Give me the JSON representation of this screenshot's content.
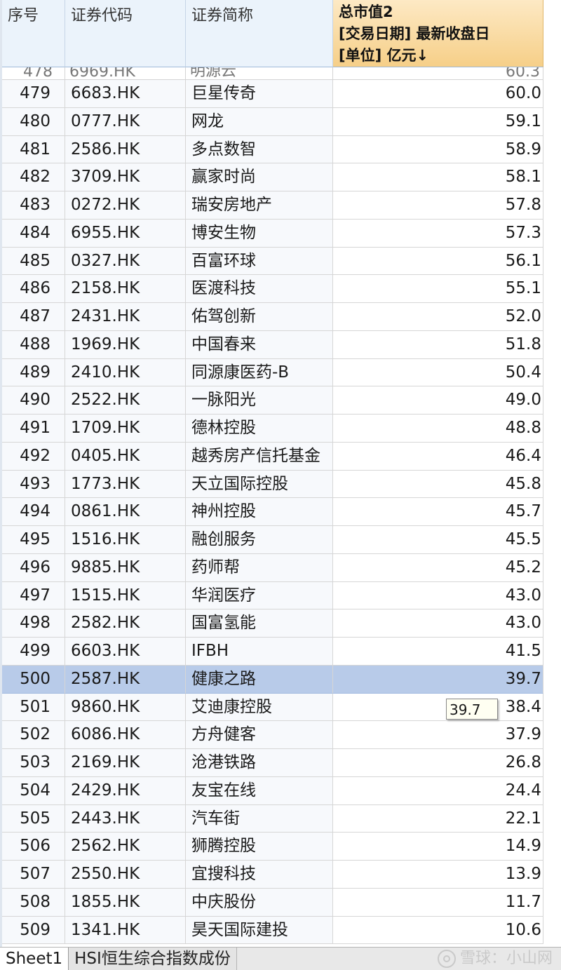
{
  "header": {
    "seq": "序号",
    "code": "证券代码",
    "name": "证券简称",
    "metric_line1": "总市值2",
    "metric_line2": "[交易日期] 最新收盘日",
    "metric_line3": "[单位] 亿元↓"
  },
  "rows": [
    {
      "seq": "479",
      "code": "6683.HK",
      "name": "巨星传奇",
      "val": "60.0"
    },
    {
      "seq": "480",
      "code": "0777.HK",
      "name": "网龙",
      "val": "59.1"
    },
    {
      "seq": "481",
      "code": "2586.HK",
      "name": "多点数智",
      "val": "58.9"
    },
    {
      "seq": "482",
      "code": "3709.HK",
      "name": "赢家时尚",
      "val": "58.1"
    },
    {
      "seq": "483",
      "code": "0272.HK",
      "name": "瑞安房地产",
      "val": "57.8"
    },
    {
      "seq": "484",
      "code": "6955.HK",
      "name": "博安生物",
      "val": "57.3"
    },
    {
      "seq": "485",
      "code": "0327.HK",
      "name": "百富环球",
      "val": "56.1"
    },
    {
      "seq": "486",
      "code": "2158.HK",
      "name": "医渡科技",
      "val": "55.1"
    },
    {
      "seq": "487",
      "code": "2431.HK",
      "name": "佑驾创新",
      "val": "52.0"
    },
    {
      "seq": "488",
      "code": "1969.HK",
      "name": "中国春来",
      "val": "51.8"
    },
    {
      "seq": "489",
      "code": "2410.HK",
      "name": "同源康医药-B",
      "val": "50.4"
    },
    {
      "seq": "490",
      "code": "2522.HK",
      "name": "一脉阳光",
      "val": "49.0"
    },
    {
      "seq": "491",
      "code": "1709.HK",
      "name": "德林控股",
      "val": "48.8"
    },
    {
      "seq": "492",
      "code": "0405.HK",
      "name": "越秀房产信托基金",
      "val": "46.4"
    },
    {
      "seq": "493",
      "code": "1773.HK",
      "name": "天立国际控股",
      "val": "45.8"
    },
    {
      "seq": "494",
      "code": "0861.HK",
      "name": "神州控股",
      "val": "45.7"
    },
    {
      "seq": "495",
      "code": "1516.HK",
      "name": "融创服务",
      "val": "45.5"
    },
    {
      "seq": "496",
      "code": "9885.HK",
      "name": "药师帮",
      "val": "45.2"
    },
    {
      "seq": "497",
      "code": "1515.HK",
      "name": "华润医疗",
      "val": "43.0"
    },
    {
      "seq": "498",
      "code": "2582.HK",
      "name": "国富氢能",
      "val": "43.0"
    },
    {
      "seq": "499",
      "code": "6603.HK",
      "name": "IFBH",
      "val": "41.5"
    },
    {
      "seq": "500",
      "code": "2587.HK",
      "name": "健康之路",
      "val": "39.7",
      "selected": true
    },
    {
      "seq": "501",
      "code": "9860.HK",
      "name": "艾迪康控股",
      "val": "38.4"
    },
    {
      "seq": "502",
      "code": "6086.HK",
      "name": "方舟健客",
      "val": "37.9"
    },
    {
      "seq": "503",
      "code": "2169.HK",
      "name": "沧港铁路",
      "val": "26.8"
    },
    {
      "seq": "504",
      "code": "2429.HK",
      "name": "友宝在线",
      "val": "24.4"
    },
    {
      "seq": "505",
      "code": "2443.HK",
      "name": "汽车街",
      "val": "22.1"
    },
    {
      "seq": "506",
      "code": "2562.HK",
      "name": "狮腾控股",
      "val": "14.9"
    },
    {
      "seq": "507",
      "code": "2550.HK",
      "name": "宜搜科技",
      "val": "13.9"
    },
    {
      "seq": "508",
      "code": "1855.HK",
      "name": "中庆股份",
      "val": "11.7"
    },
    {
      "seq": "509",
      "code": "1341.HK",
      "name": "昊天国际建投",
      "val": "10.6"
    }
  ],
  "tooltip": "39.7",
  "tabs": [
    "Sheet1",
    "HSI恒生综合指数成份"
  ],
  "watermark": "雪球：小山网"
}
